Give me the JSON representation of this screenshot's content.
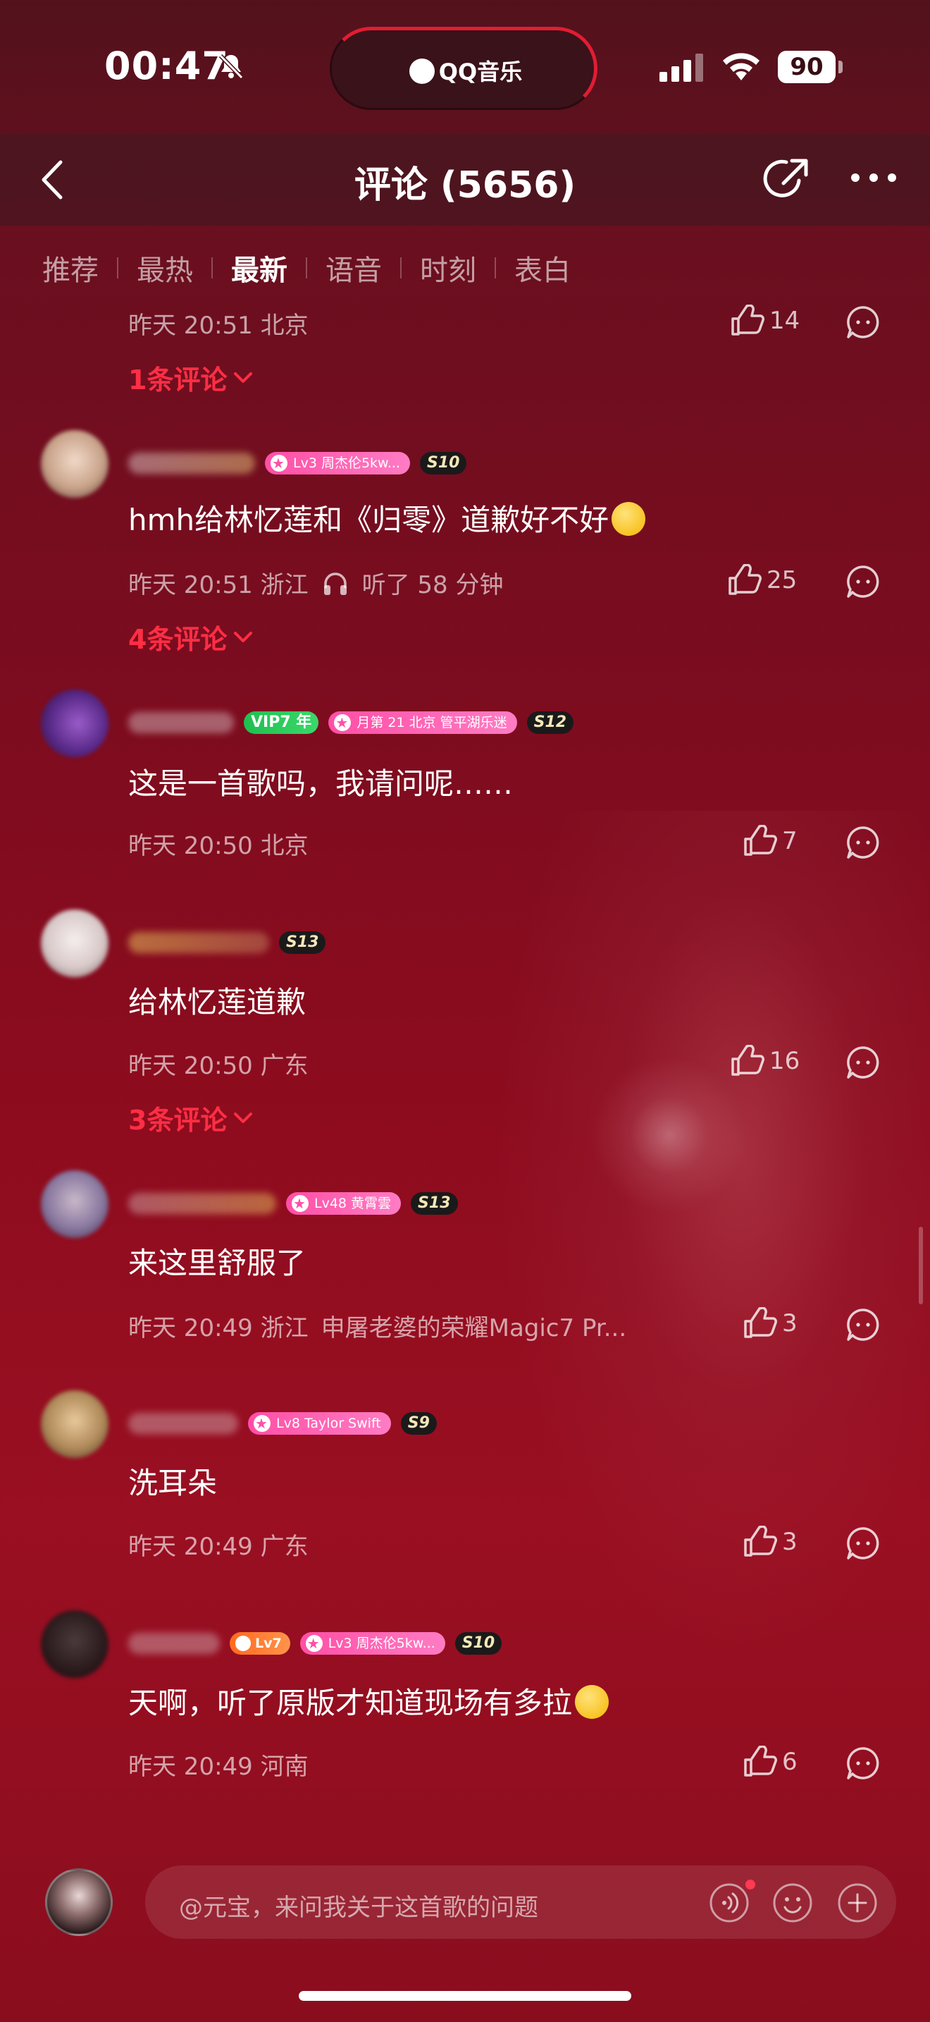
{
  "status_bar": {
    "time": "00:47",
    "island_label": "QQ音乐",
    "battery": "90"
  },
  "header": {
    "title": "评论 (5656)"
  },
  "tabs": [
    {
      "label": "推荐",
      "active": false
    },
    {
      "label": "最热",
      "active": false
    },
    {
      "label": "最新",
      "active": true
    },
    {
      "label": "语音",
      "active": false
    },
    {
      "label": "时刻",
      "active": false
    },
    {
      "label": "表白",
      "active": false
    }
  ],
  "comments": [
    {
      "meta": "昨天 20:51 北京",
      "likes": "14",
      "replies": "1条评论"
    },
    {
      "badges": [
        "Lv3 周杰伦5kw...",
        "S10"
      ],
      "text": "hmh给林忆莲和《归零》道歉好不好",
      "meta": "昨天 20:51 浙江",
      "listen": "听了 58 分钟",
      "likes": "25",
      "replies": "4条评论"
    },
    {
      "badges": [
        "VIP7 年",
        "月第 21 北京 管平湖乐迷",
        "S12"
      ],
      "text": "这是一首歌吗，我请问呢……",
      "meta": "昨天 20:50 北京",
      "likes": "7"
    },
    {
      "badges": [
        "S13"
      ],
      "text": "给林忆莲道歉",
      "meta": "昨天 20:50 广东",
      "likes": "16",
      "replies": "3条评论"
    },
    {
      "badges": [
        "Lv48 黄霄雲",
        "S13"
      ],
      "text": "来这里舒服了",
      "meta": "昨天 20:49 浙江",
      "device": "申屠老婆的荣耀Magic7 Pr...",
      "likes": "3"
    },
    {
      "badges": [
        "Lv8 Taylor Swift",
        "S9"
      ],
      "text": "洗耳朵",
      "meta": "昨天 20:49 广东",
      "likes": "3"
    },
    {
      "badges": [
        "Lv7",
        "Lv3 周杰伦5kw...",
        "S10"
      ],
      "text": "天啊，听了原版才知道现场有多拉",
      "meta": "昨天 20:49 河南",
      "likes": "6"
    }
  ],
  "input": {
    "placeholder": "@元宝，来问我关于这首歌的问题"
  },
  "colors": {
    "accent_red": "#ff2e44",
    "badge_pink": "#ff4fa6",
    "vip_green": "#1fbf4f"
  },
  "icons": [
    "bell-slash-icon",
    "signal-icon",
    "wifi-icon",
    "back-icon",
    "share-icon",
    "more-icon",
    "like-icon",
    "reply-icon",
    "headphone-icon",
    "chevron-down-icon",
    "voice-icon",
    "emoji-icon",
    "plus-icon"
  ]
}
